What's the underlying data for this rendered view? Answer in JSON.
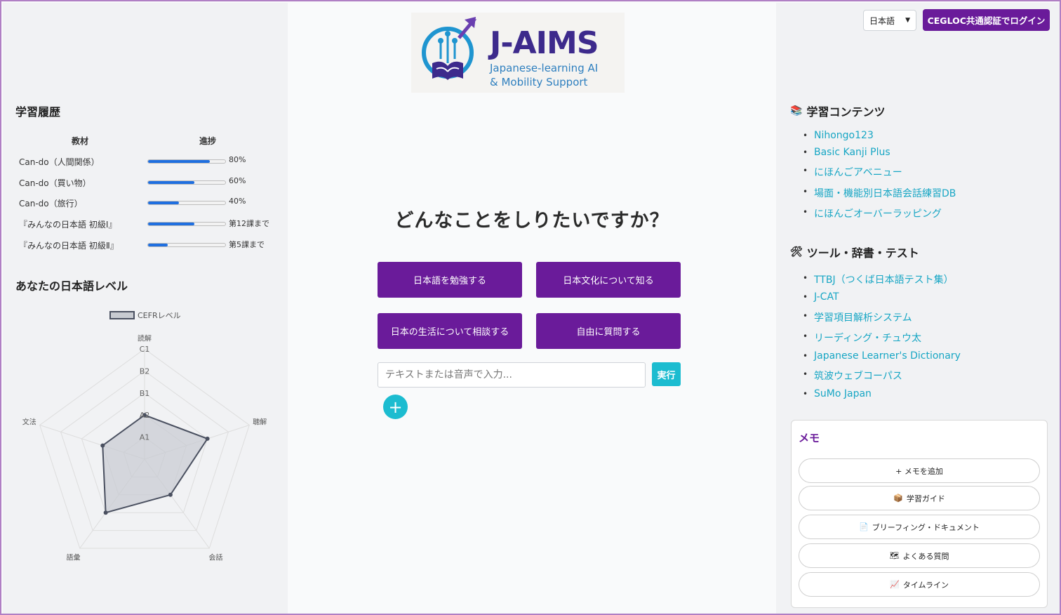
{
  "history": {
    "title": "学習履歴",
    "col_material": "教材",
    "col_progress": "進捗",
    "rows": [
      {
        "label": "Can-do（人間関係）",
        "progress": 0.8,
        "value": "80%"
      },
      {
        "label": "Can-do（買い物）",
        "progress": 0.6,
        "value": "60%"
      },
      {
        "label": "Can-do（旅行）",
        "progress": 0.4,
        "value": "40%"
      },
      {
        "label": "『みんなの日本語 初級Ⅰ』",
        "progress": 0.6,
        "value": "第12課まで"
      },
      {
        "label": "『みんなの日本語 初級Ⅱ』",
        "progress": 0.25,
        "value": "第5課まで"
      }
    ]
  },
  "level": {
    "title": "あなたの日本語レベル"
  },
  "chart_data": {
    "type": "radar",
    "legend": "CEFRレベル",
    "axes": [
      "読解",
      "聴解",
      "会話",
      "語彙",
      "文法"
    ],
    "scale_labels": [
      "A1",
      "A2",
      "B1",
      "B2",
      "C1"
    ],
    "series": [
      {
        "name": "CEFRレベル",
        "values": [
          2,
          3,
          2,
          3,
          2
        ]
      }
    ],
    "colors": {
      "line": "#4a5060",
      "fill": "#c8cbd1",
      "grid": "#dddddd"
    }
  },
  "logo": {
    "title": "J-AIMS",
    "sub1": "Japanese-learning AI",
    "sub2": "& Mobility Support"
  },
  "main": {
    "question": "どんなことをしりたいですか？",
    "buttons": [
      "日本語を勉強する",
      "日本文化について知る",
      "日本の生活について相談する",
      "自由に質問する"
    ],
    "input_placeholder": "テキストまたは音声で入力...",
    "run_label": "実行",
    "plus_label": "+"
  },
  "header": {
    "language": "日本語",
    "login_label": "CEGLOC共通認証でログイン"
  },
  "content": {
    "title": "学習コンテンツ",
    "icon": "books-icon",
    "links": [
      "Nihongo123",
      "Basic Kanji Plus",
      "にほんごアベニュー",
      "場面・機能別日本語会話練習DB",
      "にほんごオーバーラッピング"
    ]
  },
  "tools": {
    "title": "ツール・辞書・テスト",
    "icon": "tools-icon",
    "links": [
      "TTBJ（つくば日本語テスト集）",
      "J-CAT",
      "学習項目解析システム",
      "リーディング・チュウ太",
      "Japanese Learner's Dictionary",
      "筑波ウェブコーパス",
      "SuMo Japan"
    ]
  },
  "memo": {
    "title": "メモ",
    "buttons": [
      {
        "icon": "plus-icon",
        "label": "+ メモを追加"
      },
      {
        "icon": "package-icon",
        "label": "学習ガイド"
      },
      {
        "icon": "document-icon",
        "label": "ブリーフィング・ドキュメント"
      },
      {
        "icon": "map-icon",
        "label": "よくある質問"
      },
      {
        "icon": "chart-icon",
        "label": "タイムライン"
      }
    ]
  },
  "colors": {
    "accent": "#6a1b9a",
    "cyan": "#1cbcd0",
    "link": "#17a6c4",
    "bar": "#1f6fe0"
  }
}
